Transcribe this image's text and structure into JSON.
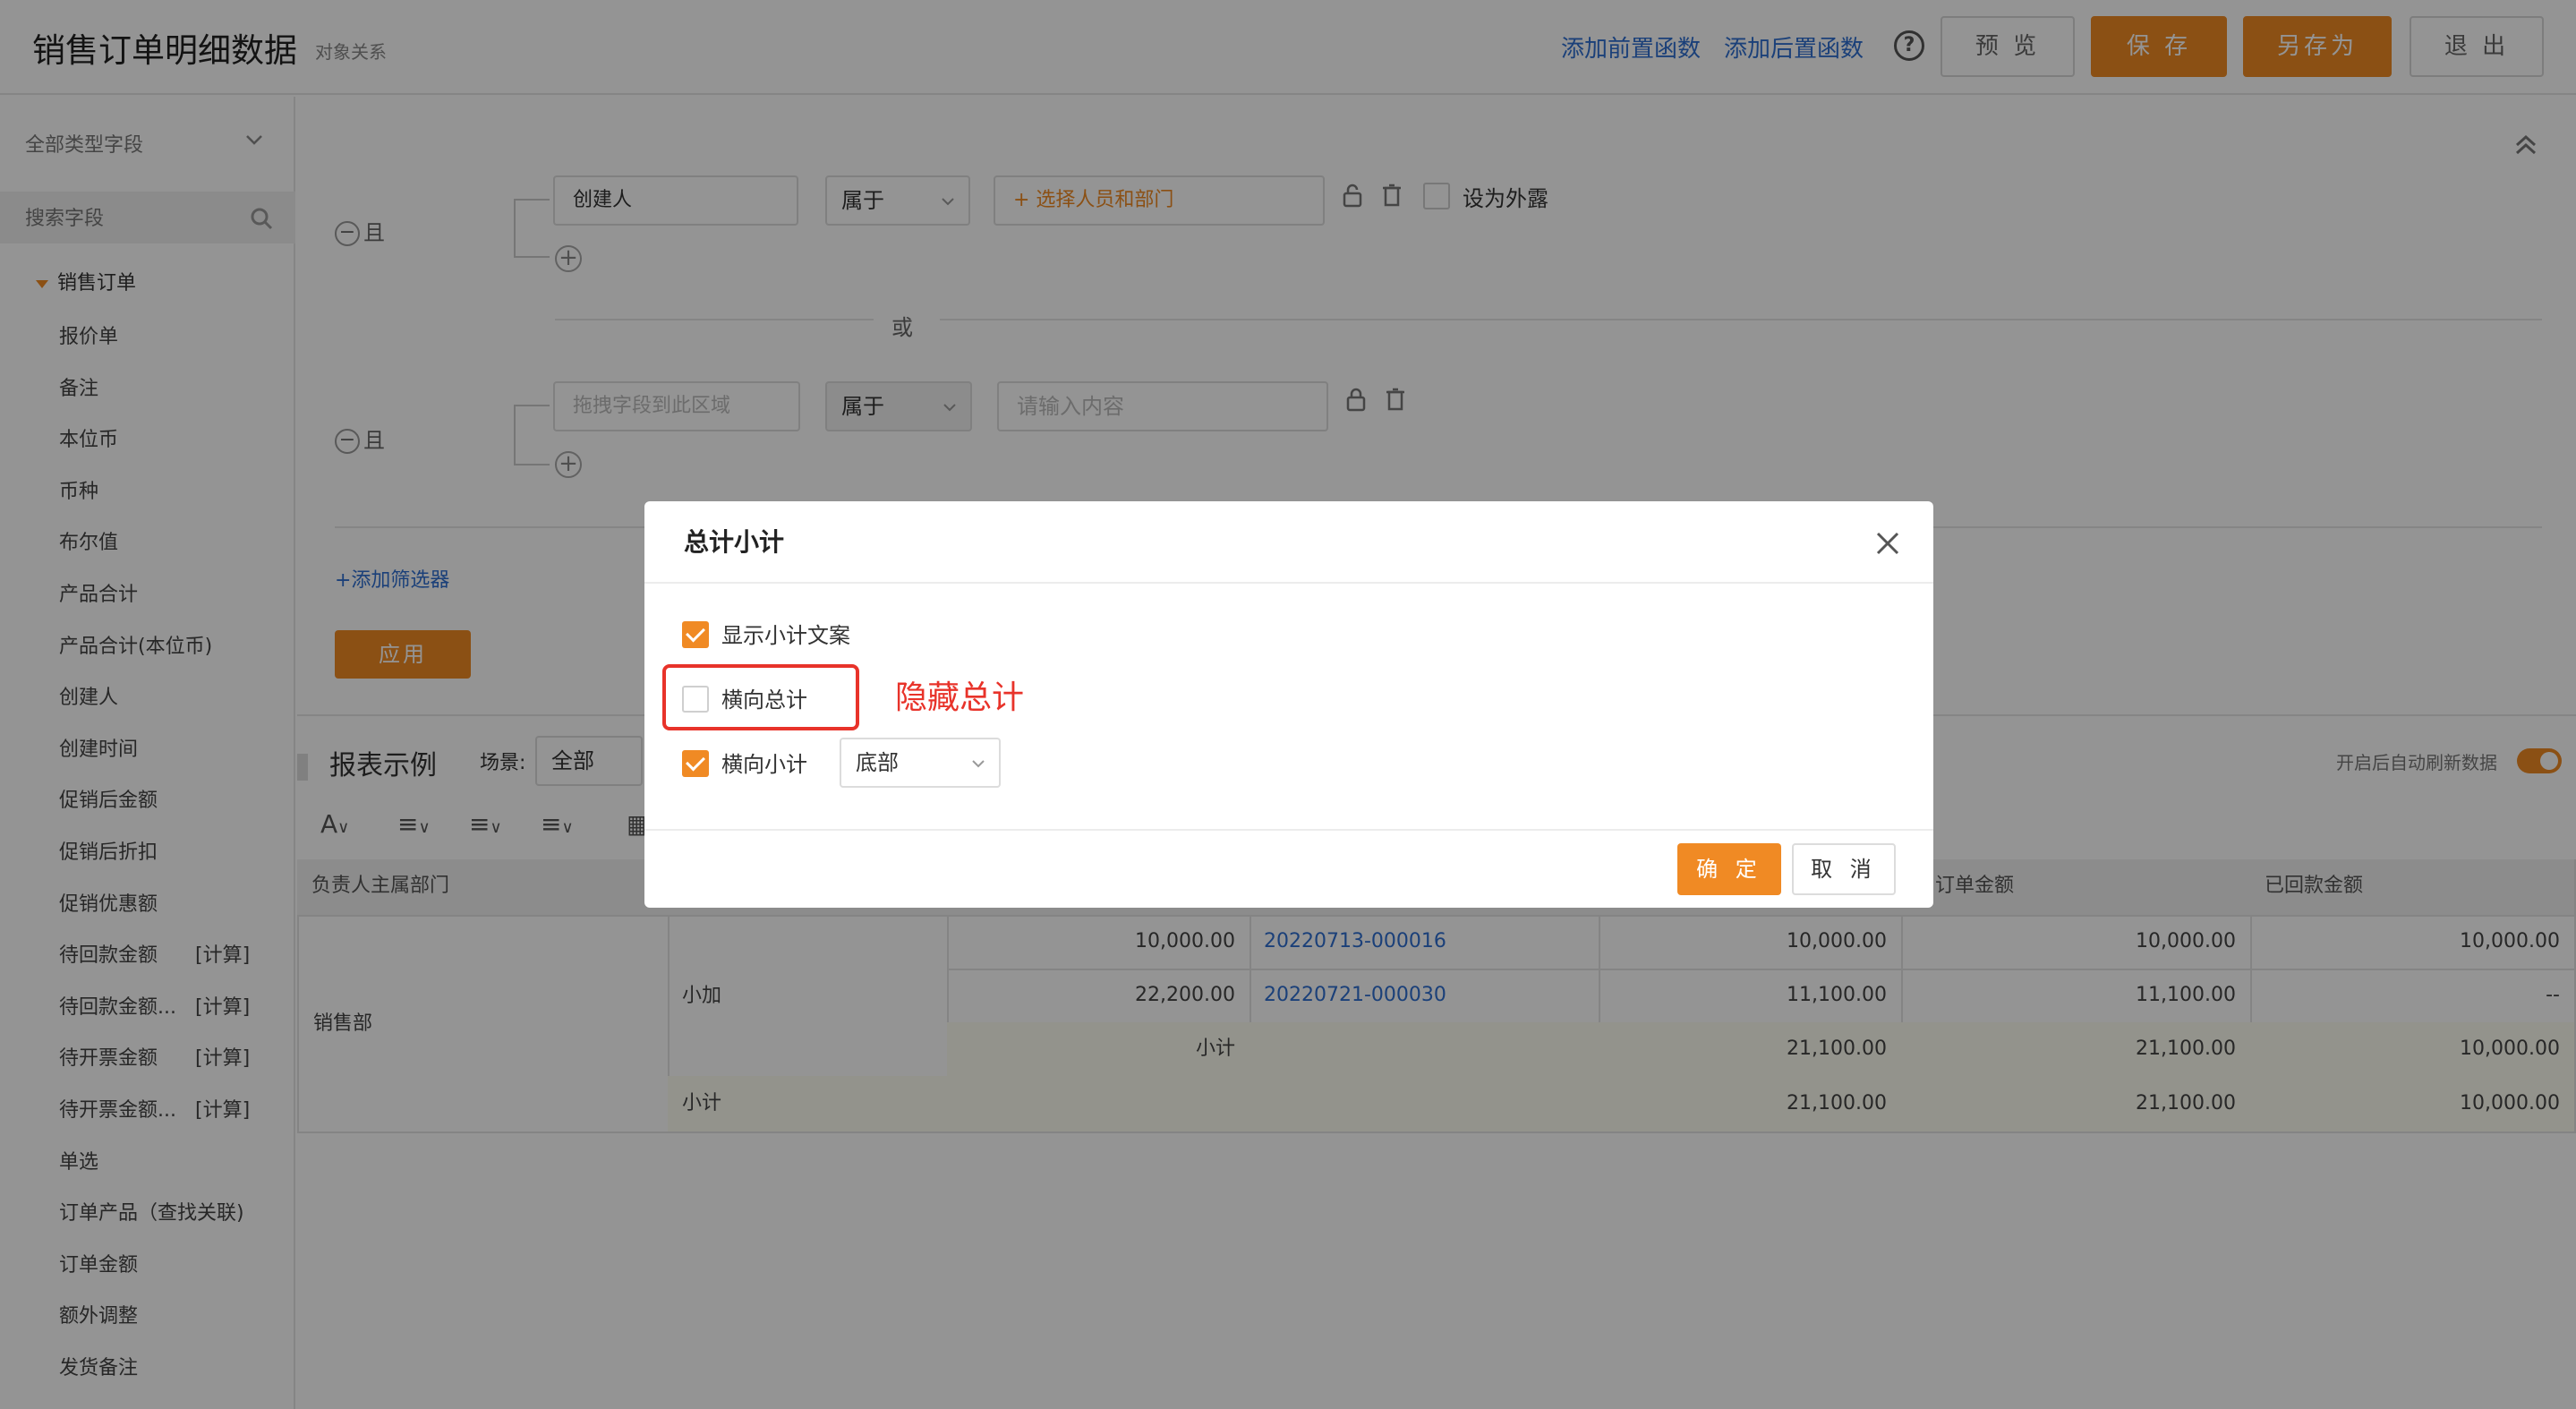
{
  "header": {
    "title": "销售订单明细数据",
    "subtitle": "对象关系",
    "add_pre_function": "添加前置函数",
    "add_post_function": "添加后置函数",
    "help": "?",
    "preview": "预 览",
    "save": "保 存",
    "save_as": "另存为",
    "exit": "退 出"
  },
  "sidebar": {
    "field_type": "全部类型字段",
    "search_placeholder": "搜索字段",
    "group": "销售订单",
    "items": [
      {
        "label": "报价单",
        "tag": ""
      },
      {
        "label": "备注",
        "tag": ""
      },
      {
        "label": "本位币",
        "tag": ""
      },
      {
        "label": "币种",
        "tag": ""
      },
      {
        "label": "布尔值",
        "tag": ""
      },
      {
        "label": "产品合计",
        "tag": ""
      },
      {
        "label": "产品合计(本位币)",
        "tag": ""
      },
      {
        "label": "创建人",
        "tag": ""
      },
      {
        "label": "创建时间",
        "tag": ""
      },
      {
        "label": "促销后金额",
        "tag": ""
      },
      {
        "label": "促销后折扣",
        "tag": ""
      },
      {
        "label": "促销优惠额",
        "tag": ""
      },
      {
        "label": "待回款金额",
        "tag": "[计算]"
      },
      {
        "label": "待回款金额...",
        "tag": "[计算]"
      },
      {
        "label": "待开票金额",
        "tag": "[计算]"
      },
      {
        "label": "待开票金额...",
        "tag": "[计算]"
      },
      {
        "label": "单选",
        "tag": ""
      },
      {
        "label": "订单产品（查找关联)",
        "tag": ""
      },
      {
        "label": "订单金额",
        "tag": ""
      },
      {
        "label": "额外调整",
        "tag": ""
      },
      {
        "label": "发货备注",
        "tag": ""
      }
    ]
  },
  "filter": {
    "and_label": "且",
    "or_label": "或",
    "row1": {
      "field": "创建人",
      "operator": "属于",
      "value_placeholder": "+ 选择人员和部门",
      "expose_label": "设为外露"
    },
    "row2": {
      "field_placeholder": "拖拽字段到此区域",
      "operator": "属于",
      "value_placeholder": "请输入内容"
    },
    "add_filter": "+添加筛选器",
    "apply": "应用"
  },
  "report": {
    "title": "报表示例",
    "scene_label": "场景:",
    "scene_value": "全部",
    "auto_refresh": "开启后自动刷新数据",
    "headers": [
      "负责人主属部门",
      "售订单金额",
      "已回款金额"
    ],
    "dept": "销售部",
    "group_label": "小加",
    "rows": [
      {
        "amount": "10,000.00",
        "order": "20220713-000016",
        "col5": "10,000.00",
        "col6": "10,000.00",
        "col7": "10,000.00"
      },
      {
        "amount": "22,200.00",
        "order": "20220721-000030",
        "col5": "11,100.00",
        "col6": "11,100.00",
        "col7": "--"
      }
    ],
    "subtotal_label": "小计",
    "subtotal": {
      "col5": "21,100.00",
      "col6": "21,100.00",
      "col7": "10,000.00"
    },
    "total_label": "小计",
    "total": {
      "col5": "21,100.00",
      "col6": "21,100.00",
      "col7": "10,000.00"
    }
  },
  "dialog": {
    "title": "总计小计",
    "opt_show_subtotal_text": "显示小计文案",
    "opt_horizontal_total": "横向总计",
    "opt_horizontal_subtotal": "横向小计",
    "position_value": "底部",
    "annotation": "隐藏总计",
    "confirm": "确 定",
    "cancel": "取 消"
  },
  "colors": {
    "accent": "#f08a24",
    "link": "#2f6fd1",
    "annotation": "#e8332a"
  }
}
